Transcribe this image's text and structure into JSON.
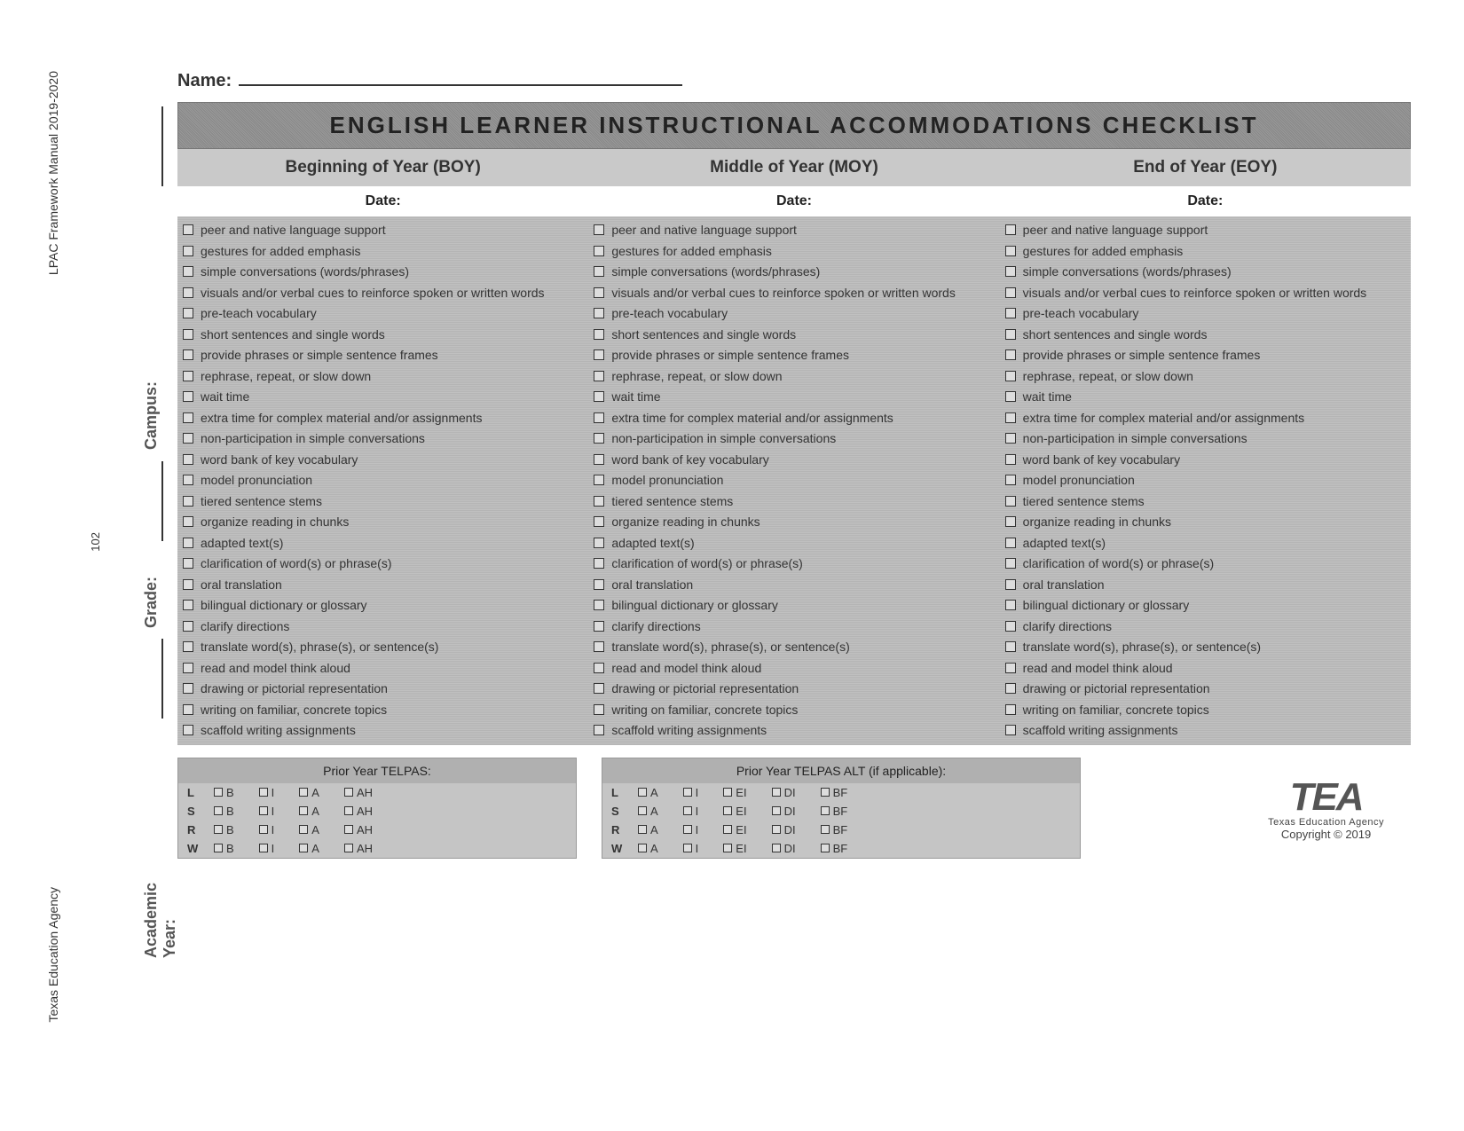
{
  "margin": {
    "top_text": "LPAC Framework Manual 2019-2020",
    "page_num": "102",
    "bottom_text": "Texas Education Agency"
  },
  "side_labels": {
    "campus": "Campus:",
    "grade": "Grade:",
    "year": "Academic Year:"
  },
  "name_label": "Name:",
  "title": "ENGLISH LEARNER INSTRUCTIONAL ACCOMMODATIONS CHECKLIST",
  "periods": {
    "boy": "Beginning of Year (BOY)",
    "moy": "Middle of Year (MOY)",
    "eoy": "End of Year (EOY)"
  },
  "date_label": "Date:",
  "items": [
    "peer and native language support",
    "gestures for added emphasis",
    "simple conversations (words/phrases)",
    "visuals and/or verbal cues to reinforce spoken or written words",
    "pre-teach vocabulary",
    "short sentences and single words",
    "provide phrases or simple sentence frames",
    "rephrase, repeat, or slow down",
    "wait time",
    "extra time for complex material and/or assignments",
    "non-participation in simple conversations",
    "word bank of key vocabulary",
    "model pronunciation",
    "tiered sentence stems",
    "organize reading in chunks",
    "adapted text(s)",
    "clarification of word(s) or phrase(s)",
    "oral translation",
    "bilingual dictionary or glossary",
    "clarify directions",
    "translate word(s), phrase(s), or sentence(s)",
    "read and model think aloud",
    "drawing or pictorial representation",
    "writing on familiar, concrete topics",
    "scaffold writing assignments"
  ],
  "telpas1": {
    "title": "Prior Year TELPAS:",
    "rows": [
      "L",
      "S",
      "R",
      "W"
    ],
    "opts": [
      "B",
      "I",
      "A",
      "AH"
    ]
  },
  "telpas2": {
    "title": "Prior Year TELPAS ALT (if applicable):",
    "rows": [
      "L",
      "S",
      "R",
      "W"
    ],
    "opts": [
      "A",
      "I",
      "EI",
      "DI",
      "BF"
    ]
  },
  "footer": {
    "logo": "TEA",
    "agency": "Texas Education Agency",
    "copyright": "Copyright © 2019"
  }
}
